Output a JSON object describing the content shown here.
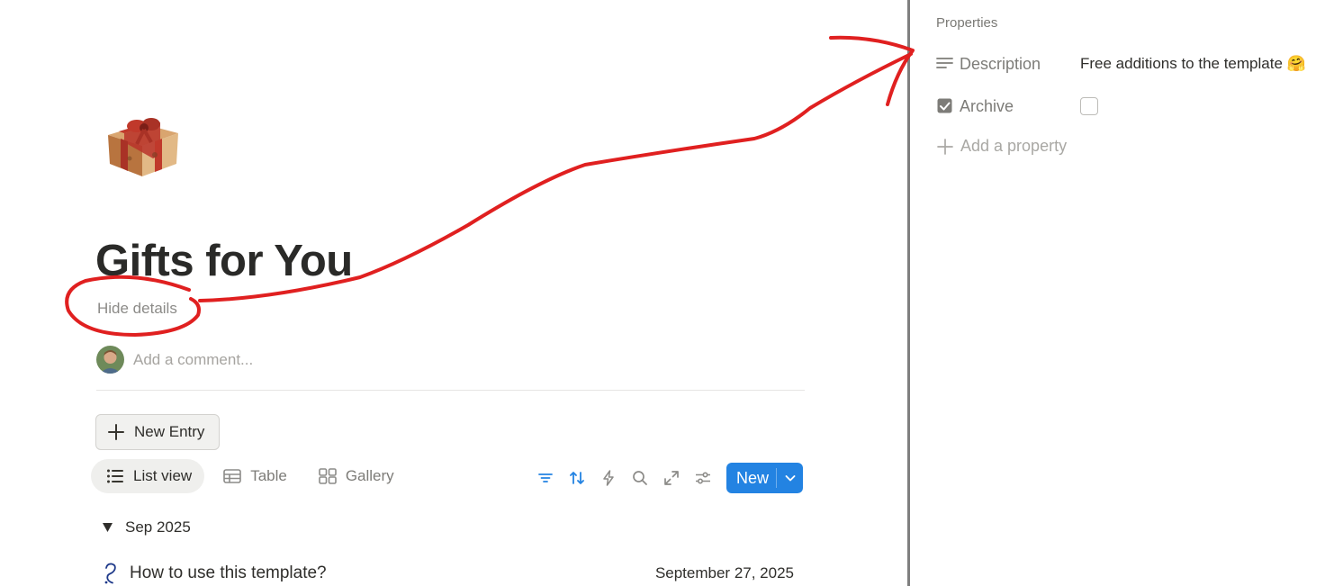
{
  "page": {
    "title": "Gifts for You",
    "hide_details_label": "Hide details",
    "comment_placeholder": "Add a comment...",
    "new_entry_label": "New Entry"
  },
  "views": {
    "tabs": [
      {
        "label": "List view",
        "active": true,
        "icon": "list-icon"
      },
      {
        "label": "Table",
        "active": false,
        "icon": "table-icon"
      },
      {
        "label": "Gallery",
        "active": false,
        "icon": "gallery-icon"
      }
    ]
  },
  "toolbar": {
    "tools": [
      "filter-icon",
      "sort-icon",
      "automation-icon",
      "search-icon",
      "expand-icon",
      "settings-icon"
    ],
    "new_label": "New",
    "accent": "#2383e2"
  },
  "groups": [
    {
      "label": "Sep 2025",
      "items": [
        {
          "title": "How to use this template?",
          "date": "September 27, 2025",
          "icon": "question-icon"
        }
      ]
    }
  ],
  "properties_panel": {
    "heading": "Properties",
    "rows": [
      {
        "name": "Description",
        "icon": "text-lines-icon",
        "value": "Free additions to the template 🤗"
      },
      {
        "name": "Archive",
        "icon": "checkbox-icon",
        "checked": false
      }
    ],
    "add_property_label": "Add a property"
  },
  "annotation": {
    "color": "#e02020"
  }
}
